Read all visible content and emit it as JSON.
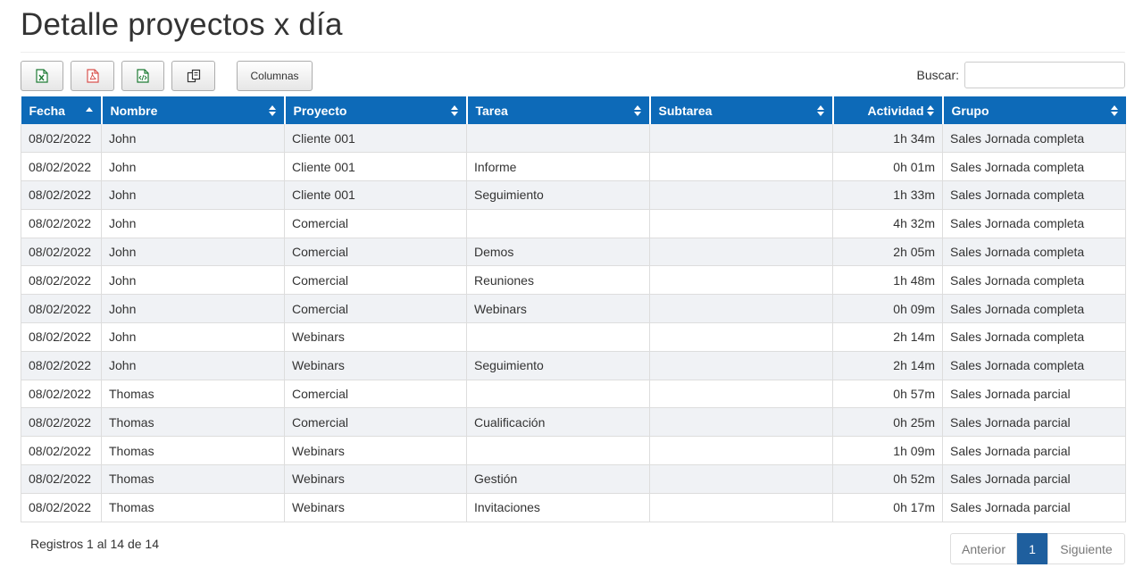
{
  "page": {
    "title": "Detalle proyectos x día"
  },
  "toolbar": {
    "excel_icon": "excel-icon",
    "pdf_icon": "pdf-icon",
    "csv_icon": "csv-icon",
    "copy_icon": "copy-icon",
    "columns_label": "Columnas"
  },
  "search": {
    "label": "Buscar:",
    "value": "",
    "placeholder": ""
  },
  "colors": {
    "header_bg": "#0d6ab8",
    "stripe": "#f0f2f5",
    "pager_active": "#1f5f9e"
  },
  "table": {
    "columns": [
      {
        "label": "Fecha",
        "sort": "asc"
      },
      {
        "label": "Nombre",
        "sort": "both"
      },
      {
        "label": "Proyecto",
        "sort": "both"
      },
      {
        "label": "Tarea",
        "sort": "both"
      },
      {
        "label": "Subtarea",
        "sort": "both"
      },
      {
        "label": "Actividad",
        "sort": "both"
      },
      {
        "label": "Grupo",
        "sort": "both"
      }
    ],
    "rows": [
      [
        "08/02/2022",
        "John",
        "Cliente 001",
        "",
        "",
        "1h 34m",
        "Sales Jornada completa"
      ],
      [
        "08/02/2022",
        "John",
        "Cliente 001",
        "Informe",
        "",
        "0h 01m",
        "Sales Jornada completa"
      ],
      [
        "08/02/2022",
        "John",
        "Cliente 001",
        "Seguimiento",
        "",
        "1h 33m",
        "Sales Jornada completa"
      ],
      [
        "08/02/2022",
        "John",
        "Comercial",
        "",
        "",
        "4h 32m",
        "Sales Jornada completa"
      ],
      [
        "08/02/2022",
        "John",
        "Comercial",
        "Demos",
        "",
        "2h 05m",
        "Sales Jornada completa"
      ],
      [
        "08/02/2022",
        "John",
        "Comercial",
        "Reuniones",
        "",
        "1h 48m",
        "Sales Jornada completa"
      ],
      [
        "08/02/2022",
        "John",
        "Comercial",
        "Webinars",
        "",
        "0h 09m",
        "Sales Jornada completa"
      ],
      [
        "08/02/2022",
        "John",
        "Webinars",
        "",
        "",
        "2h 14m",
        "Sales Jornada completa"
      ],
      [
        "08/02/2022",
        "John",
        "Webinars",
        "Seguimiento",
        "",
        "2h 14m",
        "Sales Jornada completa"
      ],
      [
        "08/02/2022",
        "Thomas",
        "Comercial",
        "",
        "",
        "0h 57m",
        "Sales Jornada parcial"
      ],
      [
        "08/02/2022",
        "Thomas",
        "Comercial",
        "Cualificación",
        "",
        "0h 25m",
        "Sales Jornada parcial"
      ],
      [
        "08/02/2022",
        "Thomas",
        "Webinars",
        "",
        "",
        "1h 09m",
        "Sales Jornada parcial"
      ],
      [
        "08/02/2022",
        "Thomas",
        "Webinars",
        "Gestión",
        "",
        "0h 52m",
        "Sales Jornada parcial"
      ],
      [
        "08/02/2022",
        "Thomas",
        "Webinars",
        "Invitaciones",
        "",
        "0h 17m",
        "Sales Jornada parcial"
      ]
    ]
  },
  "footer": {
    "info": "Registros 1 al 14 de 14",
    "prev_label": "Anterior",
    "current_page": "1",
    "next_label": "Siguiente"
  }
}
